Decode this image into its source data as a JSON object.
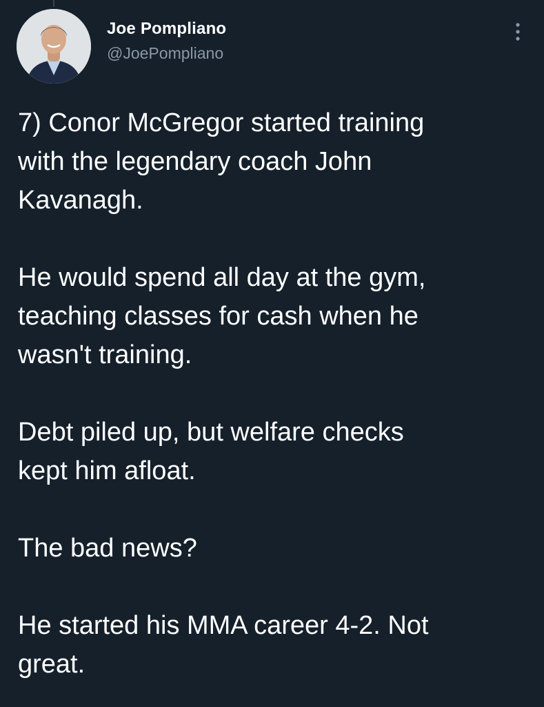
{
  "tweet": {
    "author": {
      "display_name": "Joe Pompliano",
      "handle": "@JoePompliano",
      "avatar": "profile-photo"
    },
    "more_icon": "vertical-ellipsis-icon",
    "paragraphs": [
      "7) Conor McGregor started training\nwith the legendary coach John\nKavanagh.",
      "He would spend all day at the gym,\nteaching classes for cash when he\nwasn't training.",
      "Debt piled up, but welfare checks\nkept him afloat.",
      "The bad news?",
      "He started his MMA career 4-2. Not\ngreat."
    ]
  },
  "colors": {
    "background": "#15202b",
    "text": "#ffffff",
    "secondary_text": "#8b98a5",
    "thread_line": "#38444d"
  }
}
